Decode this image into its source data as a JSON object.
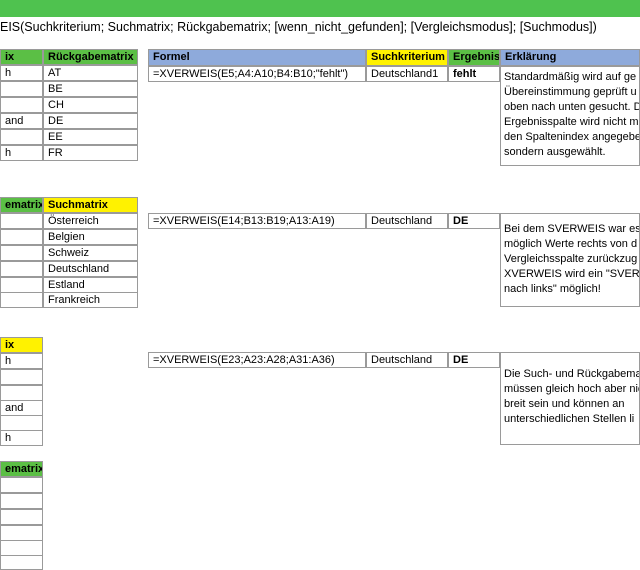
{
  "syntax": "EIS(Suchkriterium; Suchmatrix; Rückgabematrix; [wenn_nicht_gefunden]; [Vergleichsmodus]; [Suchmodus])",
  "colors": {
    "green": "#5bbf45",
    "yellow": "#fff200",
    "blue": "#8eaadb",
    "bar": "#4fc24f"
  },
  "t1": {
    "h1": "ix",
    "h2": "Rückgabematrix",
    "left": [
      "h",
      "",
      "",
      "and",
      "",
      "h"
    ],
    "right": [
      "AT",
      "BE",
      "CH",
      "DE",
      "EE",
      "FR"
    ]
  },
  "t2": {
    "h1": "ematrix",
    "h2": "Suchmatrix",
    "left": [
      "",
      "",
      "",
      "",
      "",
      ""
    ],
    "right": [
      "Österreich",
      "Belgien",
      "Schweiz",
      "Deutschland",
      "Estland",
      "Frankreich"
    ]
  },
  "t3": {
    "h1": "ix",
    "left": [
      "h",
      "",
      "",
      "and",
      "",
      "h"
    ]
  },
  "t4": {
    "h1": "ematrix",
    "left": [
      "",
      "",
      "",
      "",
      "",
      ""
    ]
  },
  "headers": {
    "formel": "Formel",
    "such": "Suchkriterium",
    "erg": "Ergebnis",
    "erkl": "Erklärung"
  },
  "rows": [
    {
      "formel": "=XVERWEIS(E5;A4:A10;B4:B10;\"fehlt\")",
      "such": "Deutschland1",
      "erg": "fehlt",
      "erkl": [
        "Standardmäßig wird auf ge",
        "Übereinstimmung geprüft u",
        "oben nach unten gesucht. D",
        "Ergebnisspalte wird nicht m",
        "den Spaltenindex angegebe",
        "sondern ausgewählt."
      ]
    },
    {
      "formel": "=XVERWEIS(E14;B13:B19;A13:A19)",
      "such": "Deutschland",
      "erg": "DE",
      "erkl": [
        "Bei dem SVERWEIS war es n",
        "möglich Werte rechts von d",
        "Vergleichsspalte zurückzug",
        "XVERWEIS wird ein \"SVER",
        "nach links\" möglich!"
      ]
    },
    {
      "formel": "=XVERWEIS(E23;A23:A28;A31:A36)",
      "such": "Deutschland",
      "erg": "DE",
      "erkl": [
        "Die Such- und Rückgabema",
        "müssen gleich hoch aber nic",
        "breit sein und können an",
        "unterschiedlichen Stellen li"
      ]
    }
  ]
}
